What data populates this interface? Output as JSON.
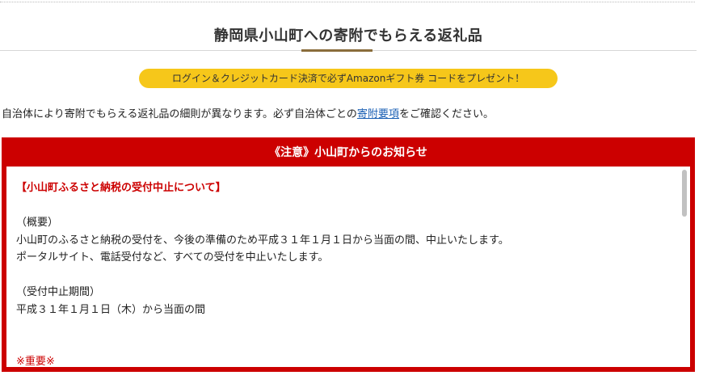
{
  "page": {
    "title": "静岡県小山町への寄附でもらえる返礼品"
  },
  "promo": {
    "label": "ログイン＆クレジットカード決済で必ずAmazonギフト券 コードをプレゼント！",
    "color": "#f6c71a"
  },
  "notice": {
    "before": "自治体により寄附でもらえる返礼品の細則が異なります。必ず自治体ごとの",
    "link": "寄附要項",
    "after": "をご確認ください。"
  },
  "alert": {
    "header": "《注意》小山町からのお知らせ",
    "accent": "#cc0000",
    "heading": "【小山町ふるさと納税の受付中止について】",
    "overview_label": "（概要）",
    "overview_line1": "小山町のふるさと納税の受付を、今後の準備のため平成３１年１月１日から当面の間、中止いたします。",
    "overview_line2": "ポータルサイト、電話受付など、すべての受付を中止いたします。",
    "period_label": "（受付中止期間）",
    "period_value": "平成３１年１月１日（木）から当面の間",
    "important": "※重要※"
  }
}
